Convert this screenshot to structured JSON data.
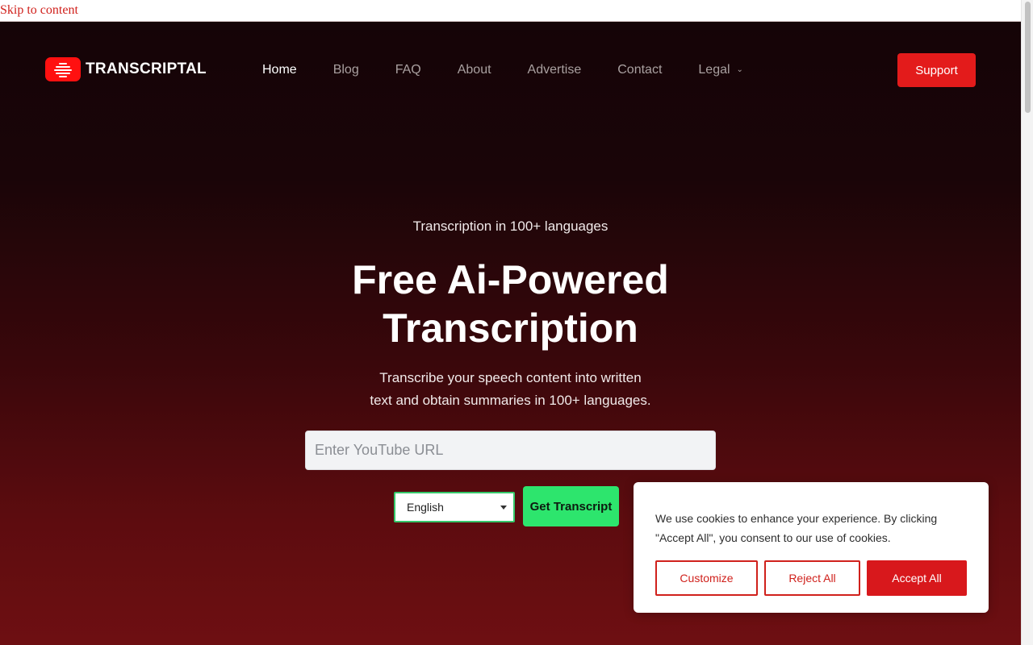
{
  "skip_link": "Skip to content",
  "brand": {
    "name": "TRANSCRIPTAL",
    "logo_color": "#ff1010"
  },
  "nav": {
    "items": [
      {
        "label": "Home",
        "active": true
      },
      {
        "label": "Blog"
      },
      {
        "label": "FAQ"
      },
      {
        "label": "About"
      },
      {
        "label": "Advertise"
      },
      {
        "label": "Contact"
      },
      {
        "label": "Legal",
        "dropdown": true
      }
    ],
    "support_label": "Support"
  },
  "hero": {
    "eyebrow": "Transcription in 100+ languages",
    "headline_line1": "Free Ai-Powered",
    "headline_line2": "Transcription",
    "subtext_line1": "Transcribe your speech content into written",
    "subtext_line2": "text and obtain summaries in 100+ languages."
  },
  "form": {
    "url_placeholder": "Enter YouTube URL",
    "url_value": "",
    "language_selected": "English",
    "submit_label": "Get Transcript",
    "submit_color": "#2de56d"
  },
  "cookie_banner": {
    "text_line1": "We use cookies to enhance your experience. By clicking",
    "text_line2": "\"Accept All\", you consent to our use of cookies.",
    "customize_label": "Customize",
    "reject_label": "Reject All",
    "accept_label": "Accept All",
    "accent_color": "#d8181c"
  }
}
